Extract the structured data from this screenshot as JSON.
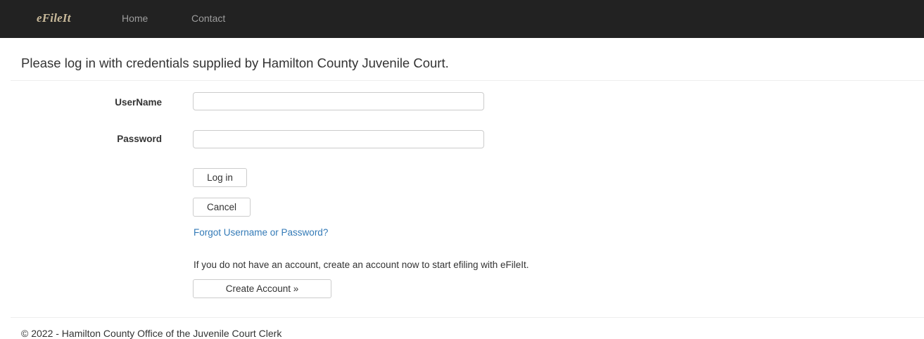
{
  "navbar": {
    "brand": "eFileIt",
    "links": [
      "Home",
      "Contact"
    ],
    "background": "#222222"
  },
  "intro": "Please log in with credentials supplied by Hamilton County Juvenile Court.",
  "form": {
    "username_label": "UserName",
    "username_value": "",
    "password_label": "Password",
    "password_value": "",
    "login_label": "Log in",
    "cancel_label": "Cancel",
    "forgot_link": "Forgot Username or Password?",
    "info_text": "If you do not have an account, create an account now to start efiling with eFileIt.",
    "create_label": "Create Account »"
  },
  "footer": "© 2022 - Hamilton County Office of the Juvenile Court Clerk",
  "colors": {
    "link": "#337ab7",
    "brand": "#c8b99a"
  }
}
